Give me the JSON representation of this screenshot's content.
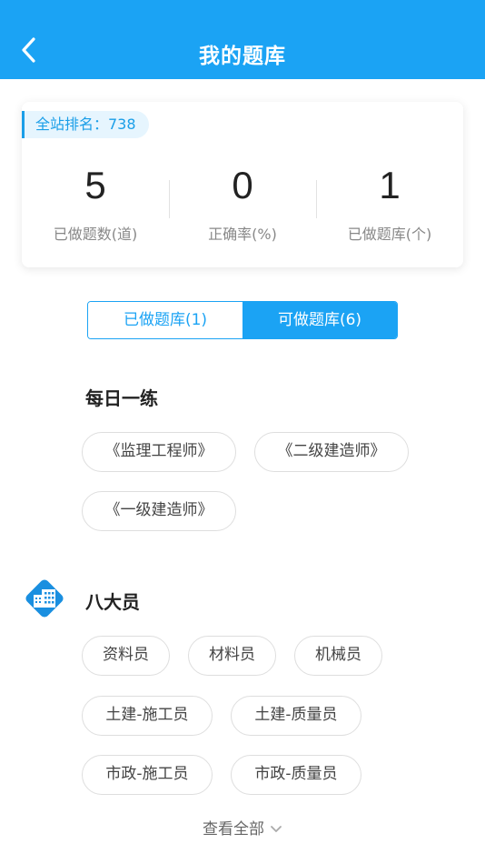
{
  "header": {
    "title": "我的题库"
  },
  "stats": {
    "rank_label": "全站排名：738",
    "items": [
      {
        "value": "5",
        "label": "已做题数(道)"
      },
      {
        "value": "0",
        "label": "正确率(%)"
      },
      {
        "value": "1",
        "label": "已做题库(个)"
      }
    ]
  },
  "tabs": [
    {
      "label": "已做题库(1)",
      "active": false
    },
    {
      "label": "可做题库(6)",
      "active": true
    }
  ],
  "daily": {
    "title": "每日一练",
    "chips": [
      "《监理工程师》",
      "《二级建造师》",
      "《一级建造师》"
    ]
  },
  "eight": {
    "title": "八大员",
    "chips": [
      "资料员",
      "材料员",
      "机械员",
      "土建-施工员",
      "土建-质量员",
      "市政-施工员",
      "市政-质量员"
    ]
  },
  "view_all": "查看全部",
  "colors": {
    "primary": "#1ba3f4",
    "icon_bg": "#1a8fe0"
  },
  "icons": {
    "back": "chevron-left-icon",
    "category": "building-icon",
    "expand": "chevron-down-icon"
  }
}
